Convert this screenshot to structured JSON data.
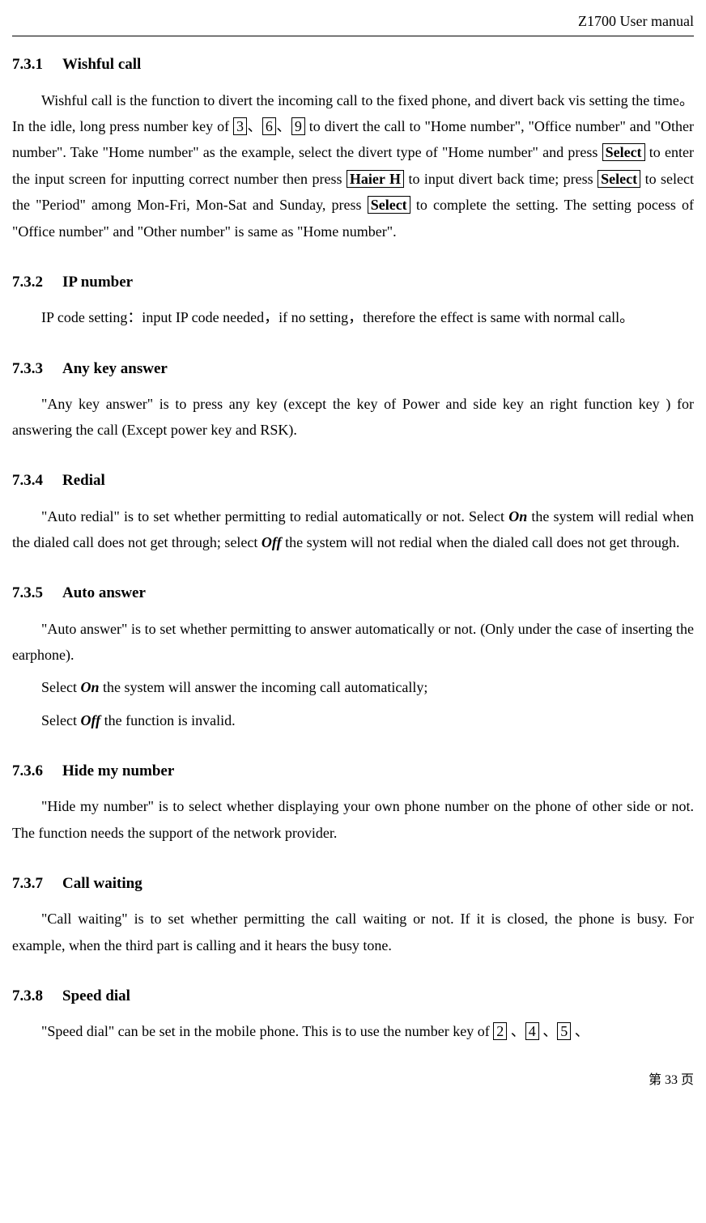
{
  "header": {
    "title": "Z1700 User manual"
  },
  "sections": {
    "s1": {
      "num": "7.3.1",
      "title": "Wishful call",
      "p_a": "Wishful call is the function to divert the incoming call to the fixed phone, and divert back vis setting the time。In the idle, long press number key of ",
      "k1": "3",
      "sep1": "、",
      "k2": "6",
      "sep2": "、",
      "k3": "9",
      "p_b": " to divert the call to \"Home number\", \"Office number\" and \"Other number\". Take \"Home number\" as the example, select the divert type of \"Home number\" and press ",
      "btn1": "Select",
      "p_c": " to enter the input screen for inputting correct number then press ",
      "btn2": "Haier H",
      "p_d": " to input divert back time; press ",
      "btn3": "Select",
      "p_e": " to select the \"Period\" among Mon-Fri, Mon-Sat and Sunday, press ",
      "btn4": "Select",
      "p_f": " to complete the setting. The setting pocess of \"Office number\" and \"Other number\" is same as \"Home number\"."
    },
    "s2": {
      "num": "7.3.2",
      "title": "IP number",
      "p": "IP code setting：input IP code needed，if no setting，therefore the effect is same with normal call。"
    },
    "s3": {
      "num": "7.3.3",
      "title": "Any key answer",
      "p": "\"Any key answer\" is to press any key (except the key of Power and side key an right function key ) for answering the call (Except power key and RSK)."
    },
    "s4": {
      "num": "7.3.4",
      "title": "Redial",
      "p_a": "\"Auto redial\" is to set whether permitting to redial automatically or not. Select ",
      "on": "On",
      "p_b": " the system will redial when the dialed call does not get through; select ",
      "off": "Off",
      "p_c": " the system will not redial when the dialed call does not get through."
    },
    "s5": {
      "num": "7.3.5",
      "title": "Auto answer",
      "p1": "\"Auto answer\" is to set whether permitting to answer automatically or not. (Only under the case of inserting the earphone).",
      "p2_a": "Select ",
      "on": "On",
      "p2_b": " the system will answer the incoming call automatically;",
      "p3_a": "Select ",
      "off": "Off",
      "p3_b": " the function is invalid."
    },
    "s6": {
      "num": "7.3.6",
      "title": "Hide my number",
      "p": "\"Hide my number\" is to select whether displaying your own phone number on the phone of other side or not. The function needs the support of the network provider."
    },
    "s7": {
      "num": "7.3.7",
      "title": "Call waiting",
      "p": "\"Call waiting\" is to set whether permitting the call waiting or not. If it is closed, the phone is busy. For example, when the third part is calling and it hears the busy tone."
    },
    "s8": {
      "num": "7.3.8",
      "title": "Speed dial",
      "p_a": "\"Speed dial\" can be set in the mobile phone. This is to use the number key of ",
      "k1": "2",
      "sep1": " 、",
      "k2": "4",
      "sep2": " 、",
      "k3": "5",
      "sep3": " 、"
    }
  },
  "footer": {
    "text": "第 33 页"
  }
}
